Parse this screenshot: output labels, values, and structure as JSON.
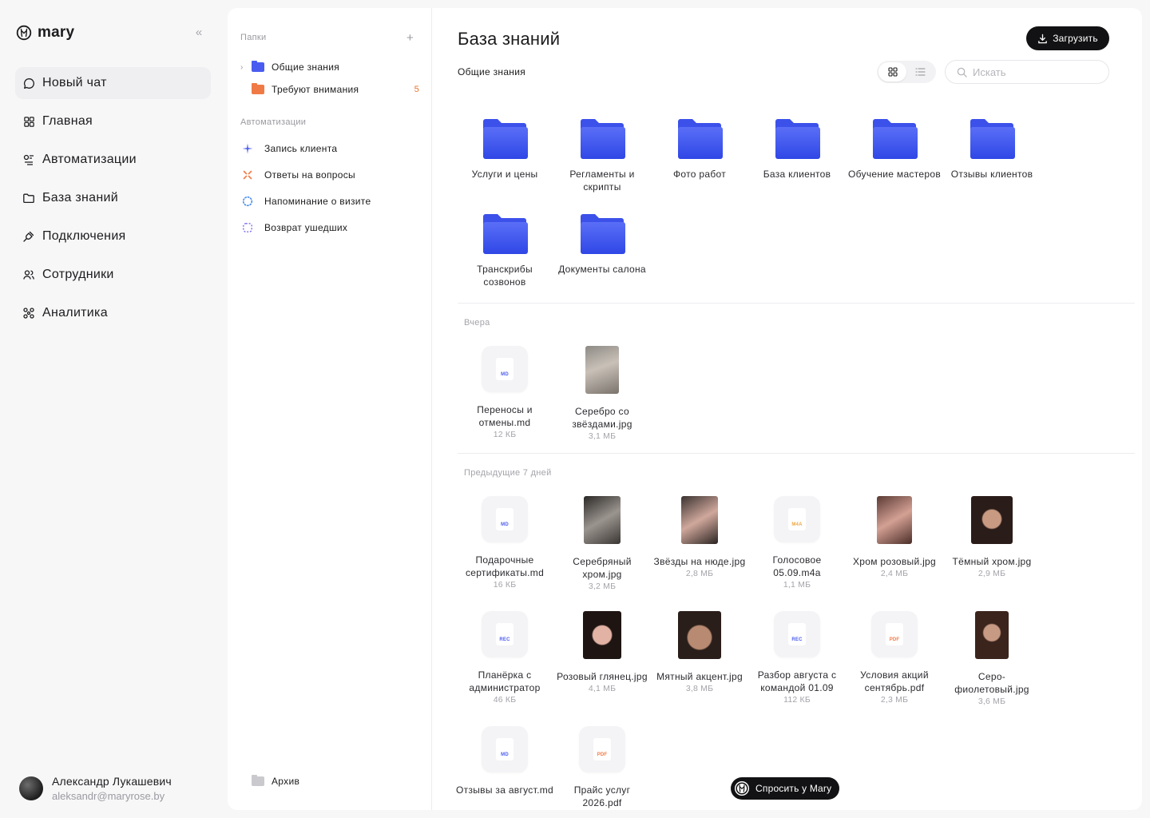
{
  "brand": {
    "name": "mary"
  },
  "sidebar": {
    "items": [
      {
        "label": "Новый чат",
        "icon": "chat-bubble-icon",
        "active": true
      },
      {
        "label": "Главная",
        "icon": "grid-icon"
      },
      {
        "label": "Автоматизации",
        "icon": "automation-icon"
      },
      {
        "label": "База знаний",
        "icon": "folder-icon"
      },
      {
        "label": "Подключения",
        "icon": "plug-icon"
      },
      {
        "label": "Сотрудники",
        "icon": "users-icon"
      },
      {
        "label": "Аналитика",
        "icon": "analytics-icon"
      }
    ]
  },
  "user": {
    "name": "Александр Лукашевич",
    "email": "aleksandr@maryrose.by"
  },
  "pane": {
    "folders_label": "Папки",
    "folders": [
      {
        "label": "Общие знания",
        "color": "#4a5cf0"
      },
      {
        "label": "Требуют внимания",
        "color": "#f07a45",
        "badge": "5"
      }
    ],
    "automations_label": "Автоматизации",
    "automations": [
      {
        "label": "Запись клиента",
        "icon": "sparkle-icon",
        "color": "#4a5cf0"
      },
      {
        "label": "Ответы на вопросы",
        "icon": "cross-sparkle-icon",
        "color": "#f07a45"
      },
      {
        "label": "Напоминание о визите",
        "icon": "dotted-circle-icon",
        "color": "#4a8cf0"
      },
      {
        "label": "Возврат ушедших",
        "icon": "dashed-square-icon",
        "color": "#7a6cf0"
      }
    ],
    "archive_label": "Архив"
  },
  "main": {
    "title": "База знаний",
    "breadcrumb": "Общие знания",
    "upload_label": "Загрузить",
    "search_placeholder": "Искать",
    "folders": [
      {
        "name": "Услуги и цены"
      },
      {
        "name": "Регламенты и скрипты"
      },
      {
        "name": "Фото работ"
      },
      {
        "name": "База клиентов"
      },
      {
        "name": "Обучение мастеров"
      },
      {
        "name": "Отзывы клиентов"
      },
      {
        "name": "Транскрибы созвонов"
      },
      {
        "name": "Документы салона"
      }
    ],
    "section_yesterday": "Вчера",
    "yesterday_files": [
      {
        "name": "Переносы и отмены.md",
        "size": "12 КБ",
        "type": "MD"
      },
      {
        "name": "Серебро со звёздами.jpg",
        "size": "3,1 МБ",
        "type": "img"
      }
    ],
    "section_week": "Предыдущие 7 дней",
    "week_files": [
      {
        "name": "Подарочные сертификаты.md",
        "size": "16 КБ",
        "type": "MD"
      },
      {
        "name": "Серебряный хром.jpg",
        "size": "3,2 МБ",
        "type": "img"
      },
      {
        "name": "Звёзды на нюде.jpg",
        "size": "2,8 МБ",
        "type": "img"
      },
      {
        "name": "Голосовое 05.09.m4a",
        "size": "1,1 МБ",
        "type": "M4A"
      },
      {
        "name": "Хром розовый.jpg",
        "size": "2,4 МБ",
        "type": "img"
      },
      {
        "name": "Тёмный хром.jpg",
        "size": "2,9 МБ",
        "type": "img"
      },
      {
        "name": "Планёрка с администратор",
        "size": "46 КБ",
        "type": "REC"
      },
      {
        "name": "Розовый глянец.jpg",
        "size": "4,1 МБ",
        "type": "img"
      },
      {
        "name": "Мятный акцент.jpg",
        "size": "3,8 МБ",
        "type": "img"
      },
      {
        "name": "Разбор августа с командой 01.09",
        "size": "112 КБ",
        "type": "REC"
      },
      {
        "name": "Условия акций сентябрь.pdf",
        "size": "2,3 МБ",
        "type": "PDF"
      },
      {
        "name": "Серо-фиолетовый.jpg",
        "size": "3,6 МБ",
        "type": "img"
      },
      {
        "name": "Отзывы за август.md",
        "size": "",
        "type": "MD"
      },
      {
        "name": "Прайс услуг 2026.pdf",
        "size": "",
        "type": "PDF"
      }
    ],
    "ask_label": "Спросить у Mary"
  },
  "colors": {
    "accent": "#4a5cf0",
    "warning": "#f07a45",
    "dark": "#121214"
  }
}
